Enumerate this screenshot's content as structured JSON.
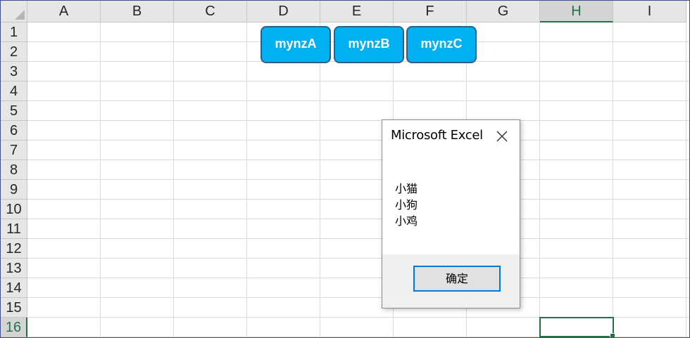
{
  "columns": [
    "A",
    "B",
    "C",
    "D",
    "E",
    "F",
    "G",
    "H",
    "I"
  ],
  "active_column": "H",
  "rows": [
    "1",
    "2",
    "3",
    "4",
    "5",
    "6",
    "7",
    "8",
    "9",
    "10",
    "11",
    "12",
    "13",
    "14",
    "15",
    "16"
  ],
  "active_row": "16",
  "sheet_buttons": [
    {
      "label": "mynzA"
    },
    {
      "label": "mynzB"
    },
    {
      "label": "mynzC"
    }
  ],
  "dialog": {
    "title": "Microsoft Excel",
    "close_icon": "close-icon",
    "message_lines": [
      "小猫",
      "小狗",
      "小鸡"
    ],
    "ok_label": "确定"
  },
  "colors": {
    "button_fill": "#00b0f0",
    "button_border": "#2f5f86",
    "excel_green": "#217346",
    "dialog_focus": "#0078d7"
  }
}
